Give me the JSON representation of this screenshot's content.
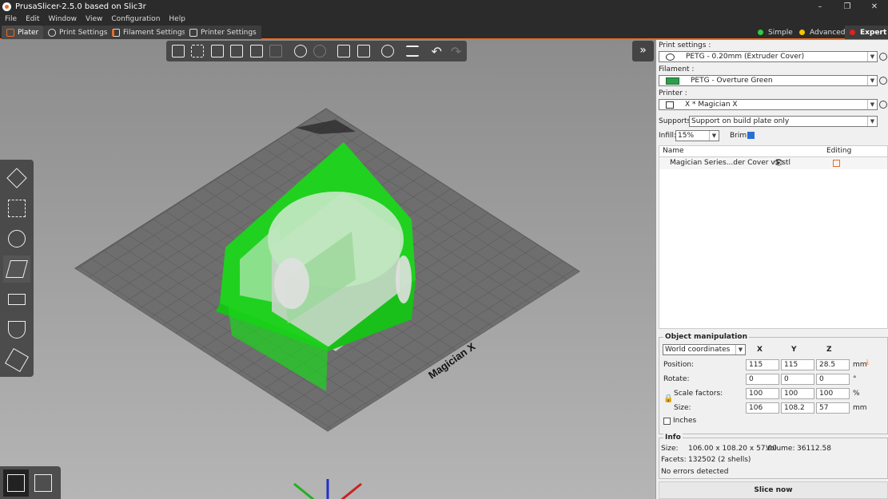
{
  "app": {
    "title": "PrusaSlicer-2.5.0 based on Slic3r"
  },
  "window_controls": {
    "minimize": "–",
    "maximize": "❐",
    "close": "✕"
  },
  "menu": [
    "File",
    "Edit",
    "Window",
    "View",
    "Configuration",
    "Help"
  ],
  "tabs": [
    {
      "label": "Plater",
      "active": true
    },
    {
      "label": "Print Settings"
    },
    {
      "label": "Filament Settings"
    },
    {
      "label": "Printer Settings"
    }
  ],
  "modes": [
    {
      "label": "Simple",
      "color": "#2ecc40"
    },
    {
      "label": "Advanced",
      "color": "#f5c400"
    },
    {
      "label": "Expert",
      "color": "#e0221b",
      "active": true
    }
  ],
  "viewport": {
    "bed_label": "Magician X",
    "accent": "#ed6b21",
    "model_color": "#22dd22"
  },
  "sidebar": {
    "collapse_label": "»",
    "print_settings_label": "Print settings :",
    "print_settings_value": "PETG - 0.20mm (Extruder Cover)",
    "filament_label": "Filament :",
    "filament_value": "PETG - Overture Green",
    "filament_color": "#2e9e4c",
    "printer_label": "Printer :",
    "printer_value": "X * Magician X",
    "supports_label": "Supports:",
    "supports_value": "Support on build plate only",
    "infill_label": "Infill:",
    "infill_value": "15%",
    "brim_label": "Brim:",
    "brim_checked": true,
    "table": {
      "col_name": "Name",
      "col_editing": "Editing",
      "rows": [
        {
          "name": "Magician Series...der Cover v1.stl"
        }
      ]
    }
  },
  "object_manipulation": {
    "title": "Object manipulation",
    "coord_system": "World coordinates",
    "x": "X",
    "y": "Y",
    "z": "Z",
    "position_label": "Position:",
    "position": [
      "115",
      "115",
      "28.5"
    ],
    "position_unit": "mm",
    "rotate_label": "Rotate:",
    "rotate": [
      "0",
      "0",
      "0"
    ],
    "rotate_unit": "°",
    "scale_label": "Scale factors:",
    "scale": [
      "100",
      "100",
      "100"
    ],
    "scale_unit": "%",
    "size_label": "Size:",
    "size": [
      "106",
      "108.2",
      "57"
    ],
    "size_unit": "mm",
    "inches_label": "Inches"
  },
  "info": {
    "title": "Info",
    "size_label": "Size:",
    "size_value": "106.00 x 108.20 x 57.00",
    "volume_label": "Volume:",
    "volume_value": "36112.58",
    "facets_label": "Facets:",
    "facets_value": "132502 (2 shells)",
    "errors": "No errors detected"
  },
  "slice_button": "Slice now"
}
